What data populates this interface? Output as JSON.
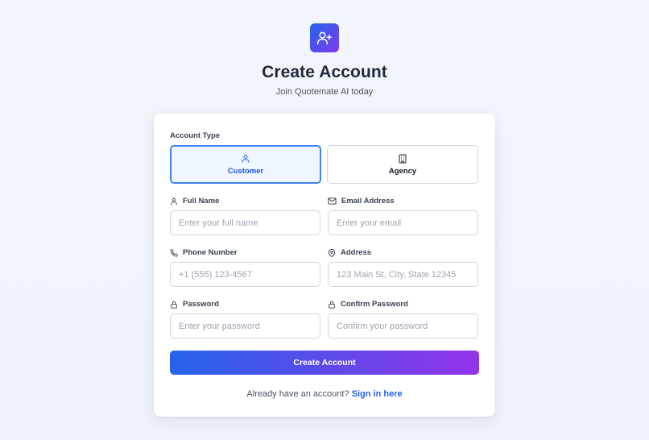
{
  "header": {
    "logo_icon": "user-plus-icon",
    "title": "Create Account",
    "subtitle": "Join Quotemate AI today"
  },
  "form": {
    "account_type": {
      "label": "Account Type",
      "options": [
        {
          "label": "Customer",
          "icon": "user-icon",
          "selected": true
        },
        {
          "label": "Agency",
          "icon": "building-icon",
          "selected": false
        }
      ]
    },
    "fields": {
      "full_name": {
        "label": "Full Name",
        "icon": "user-icon",
        "placeholder": "Enter your full name",
        "value": ""
      },
      "email": {
        "label": "Email Address",
        "icon": "mail-icon",
        "placeholder": "Enter your email",
        "value": ""
      },
      "phone": {
        "label": "Phone Number",
        "icon": "phone-icon",
        "placeholder": "+1 (555) 123-4567",
        "value": ""
      },
      "address": {
        "label": "Address",
        "icon": "map-pin-icon",
        "placeholder": "123 Main St, City, State 12345",
        "value": ""
      },
      "password": {
        "label": "Password",
        "icon": "lock-icon",
        "placeholder": "Enter your password",
        "value": ""
      },
      "confirm_password": {
        "label": "Confirm Password",
        "icon": "lock-icon",
        "placeholder": "Confirm your password",
        "value": ""
      }
    },
    "submit_label": "Create Account",
    "footer": {
      "text": "Already have an account?",
      "link_label": "Sign in here"
    }
  },
  "colors": {
    "accent_start": "#2563eb",
    "accent_end": "#9333ea",
    "selected_border": "#3b82f6",
    "selected_bg": "#eff6ff",
    "link": "#2563eb"
  }
}
